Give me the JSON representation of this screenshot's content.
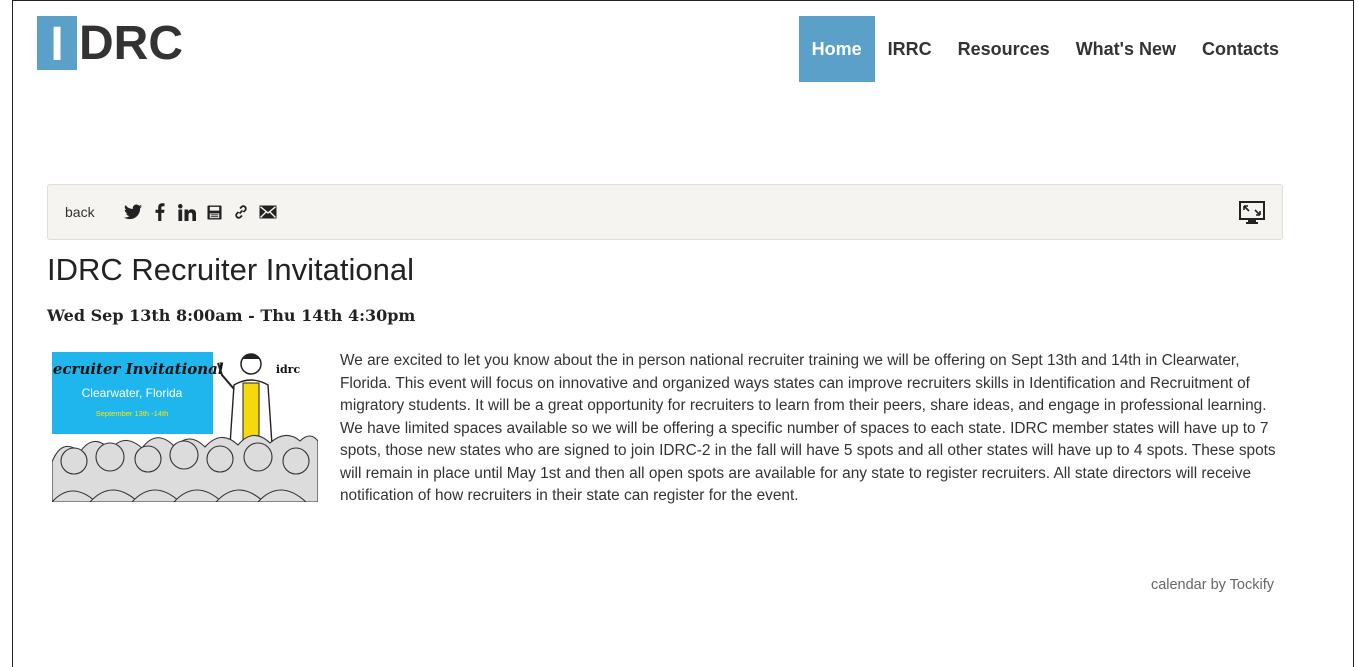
{
  "header": {
    "logo_first": "I",
    "logo_rest": "DRC",
    "nav": [
      {
        "label": "Home",
        "active": true
      },
      {
        "label": "IRRC",
        "active": false
      },
      {
        "label": "Resources",
        "active": false
      },
      {
        "label": "What's New",
        "active": false
      },
      {
        "label": "Contacts",
        "active": false
      }
    ]
  },
  "toolbar": {
    "back_label": "back",
    "share_icons": [
      "twitter-icon",
      "facebook-icon",
      "linkedin-icon",
      "save-icon",
      "link-icon",
      "email-icon"
    ],
    "fullscreen_icon": "fullscreen-icon"
  },
  "event": {
    "title": "IDRC Recruiter Invitational",
    "when": "Wed Sep 13th 8:00am - Thu 14th 4:30pm",
    "image": {
      "banner_title": "Recruiter Invitational",
      "banner_location": "Clearwater, Florida",
      "banner_dates": "September 13th -14th",
      "brand": "idrc"
    },
    "description": "We are excited to let you know about the in person national recruiter training we will be offering on Sept 13th and 14th in Clearwater, Florida. This event will focus on innovative and organized ways states can improve recruiters skills in Identification and Recruitment of migratory students. It will be a great opportunity for recruiters to learn from their peers, share ideas, and engage in professional learning. We have limited spaces available so we will be offering a specific number of spaces to each state. IDRC member states will have up to 7 spots, those new states who are signed to join IDRC-2 in the fall will have 5 spots and all other states will have up to 4 spots. These spots will remain in place until May 1st and then all open spots are available for any state to register recruiters. All state directors will receive notification of how recruiters in their state can register for the event."
  },
  "footer": {
    "credit": "calendar by Tockify"
  },
  "colors": {
    "accent": "#5aa0c8",
    "banner_blue": "#1fb6ee",
    "toolbar_bg": "#f6f4f1"
  }
}
